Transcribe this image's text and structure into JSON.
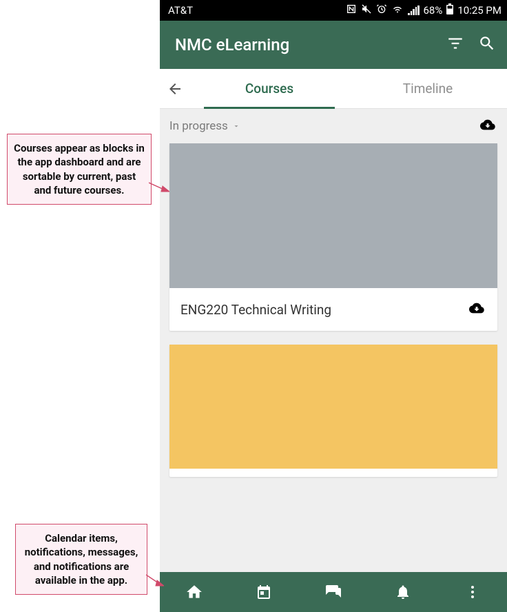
{
  "statusbar": {
    "carrier": "AT&T",
    "battery_pct": "68%",
    "time": "10:25 PM"
  },
  "appbar": {
    "title": "NMC eLearning"
  },
  "tabs": {
    "courses": "Courses",
    "timeline": "Timeline"
  },
  "filter": {
    "label": "In progress"
  },
  "courses": [
    {
      "title": "ENG220 Technical Writing"
    }
  ],
  "callouts": {
    "top": "Courses appear as blocks in the app dashboard and are sortable by current, past and future courses.",
    "bottom": "Calendar items, notifications, messages, and notifications are available in the app."
  }
}
